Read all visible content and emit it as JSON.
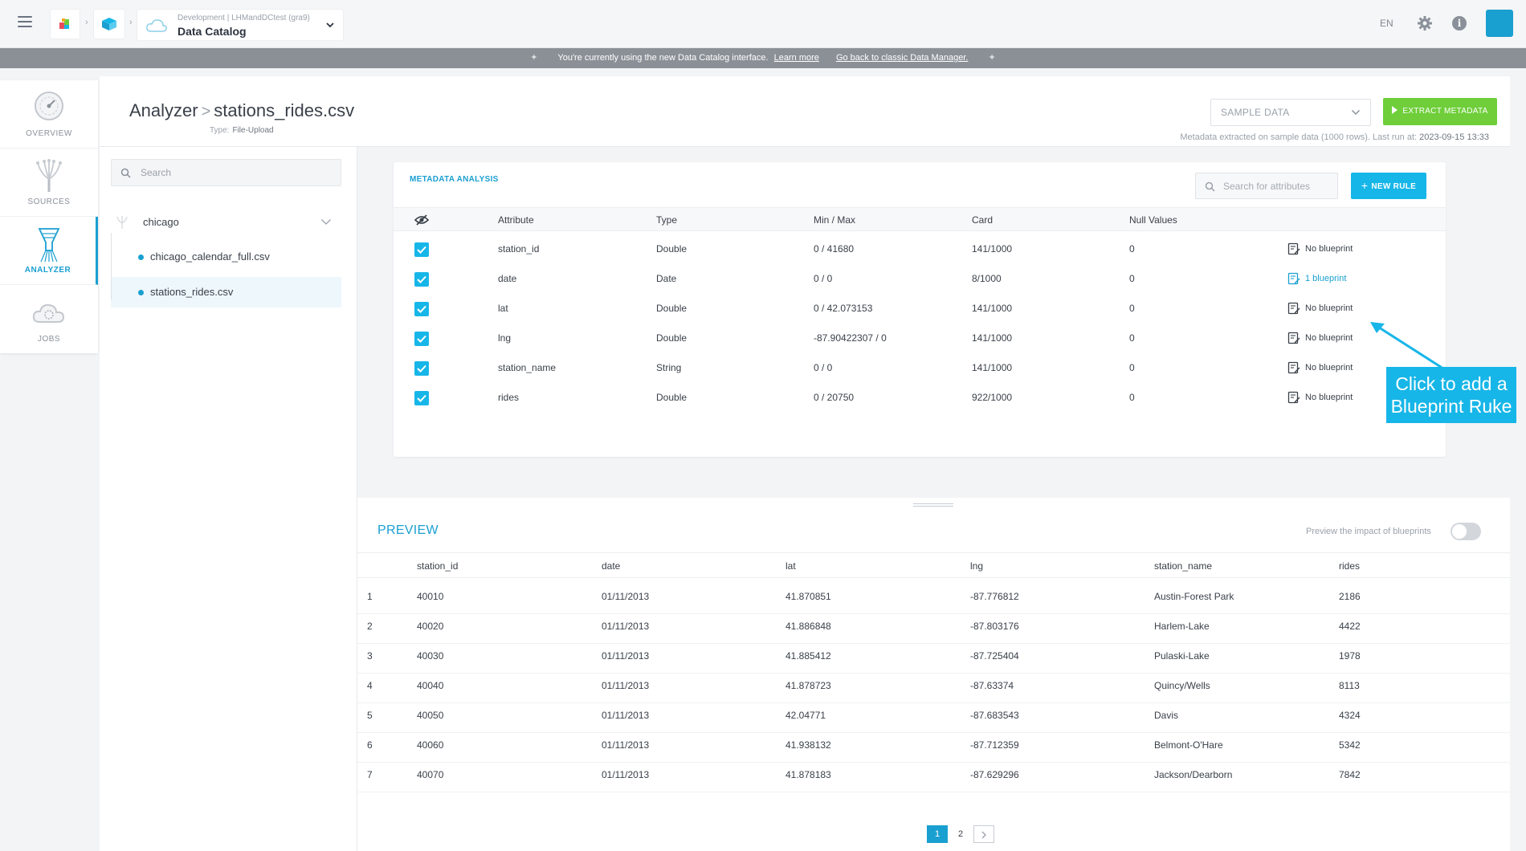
{
  "topbar": {
    "project_sub": "Development | LHMandDCtest (gra9)",
    "project_title": "Data Catalog",
    "lang": "EN",
    "info_glyph": "i"
  },
  "banner": {
    "text": "You're currently using the new Data Catalog interface.",
    "learn_more": "Learn more",
    "classic_link": "Go back to classic Data Manager."
  },
  "nav": [
    {
      "label": "OVERVIEW",
      "icon": "gauge-icon"
    },
    {
      "label": "SOURCES",
      "icon": "sources-tree-icon"
    },
    {
      "label": "ANALYZER",
      "icon": "analyzer-funnel-icon"
    },
    {
      "label": "JOBS",
      "icon": "jobs-cloud-icon"
    }
  ],
  "header": {
    "breadcrumb_root": "Analyzer",
    "breadcrumb_sep": ">",
    "file_name": "stations_rides.csv",
    "type_label": "Type:",
    "type_value": "File-Upload",
    "sample_select": "SAMPLE DATA",
    "extract_button": "EXTRACT METADATA",
    "meta_note_prefix": "Metadata extracted on sample data (1000 rows).   Last run at:",
    "meta_note_time": "2023-09-15 13:33"
  },
  "tree": {
    "search_placeholder": "Search",
    "root": "chicago",
    "files": [
      {
        "name": "chicago_calendar_full.csv",
        "selected": false
      },
      {
        "name": "stations_rides.csv",
        "selected": true
      }
    ]
  },
  "metadata": {
    "title": "METADATA ANALYSIS",
    "search_placeholder": "Search for attributes",
    "new_rule": "NEW RULE",
    "columns": [
      "Attribute",
      "Type",
      "Min / Max",
      "Card",
      "Null Values"
    ],
    "rows": [
      {
        "attribute": "station_id",
        "type": "Double",
        "minmax": "0 / 41680",
        "card": "141/1000",
        "nulls": "0",
        "blueprint": "No blueprint",
        "has_blueprint": false
      },
      {
        "attribute": "date",
        "type": "Date",
        "minmax": "0 / 0",
        "card": "8/1000",
        "nulls": "0",
        "blueprint": "1 blueprint",
        "has_blueprint": true
      },
      {
        "attribute": "lat",
        "type": "Double",
        "minmax": "0 / 42.073153",
        "card": "141/1000",
        "nulls": "0",
        "blueprint": "No blueprint",
        "has_blueprint": false
      },
      {
        "attribute": "lng",
        "type": "Double",
        "minmax": "-87.90422307 / 0",
        "card": "141/1000",
        "nulls": "0",
        "blueprint": "No blueprint",
        "has_blueprint": false
      },
      {
        "attribute": "station_name",
        "type": "String",
        "minmax": "0 / 0",
        "card": "141/1000",
        "nulls": "0",
        "blueprint": "No blueprint",
        "has_blueprint": false
      },
      {
        "attribute": "rides",
        "type": "Double",
        "minmax": "0 / 20750",
        "card": "922/1000",
        "nulls": "0",
        "blueprint": "No blueprint",
        "has_blueprint": false
      }
    ]
  },
  "annotation": {
    "line1": "Click to add a",
    "line2": "Blueprint Ruke"
  },
  "preview": {
    "title": "PREVIEW",
    "impact_label": "Preview the impact of blueprints",
    "columns": [
      "station_id",
      "date",
      "lat",
      "lng",
      "station_name",
      "rides"
    ],
    "rows": [
      [
        "1",
        "40010",
        "01/11/2013",
        "41.870851",
        "-87.776812",
        "Austin-Forest Park",
        "2186"
      ],
      [
        "2",
        "40020",
        "01/11/2013",
        "41.886848",
        "-87.803176",
        "Harlem-Lake",
        "4422"
      ],
      [
        "3",
        "40030",
        "01/11/2013",
        "41.885412",
        "-87.725404",
        "Pulaski-Lake",
        "1978"
      ],
      [
        "4",
        "40040",
        "01/11/2013",
        "41.878723",
        "-87.63374",
        "Quincy/Wells",
        "8113"
      ],
      [
        "5",
        "40050",
        "01/11/2013",
        "42.04771",
        "-87.683543",
        "Davis",
        "4324"
      ],
      [
        "6",
        "40060",
        "01/11/2013",
        "41.938132",
        "-87.712359",
        "Belmont-O'Hare",
        "5342"
      ],
      [
        "7",
        "40070",
        "01/11/2013",
        "41.878183",
        "-87.629296",
        "Jackson/Dearborn",
        "7842"
      ]
    ],
    "pages": [
      "1",
      "2"
    ],
    "current_page": "1"
  },
  "colors": {
    "accent": "#1a9fd1",
    "accent_bright": "#17b6e8",
    "extract_green": "#6fce3a"
  }
}
